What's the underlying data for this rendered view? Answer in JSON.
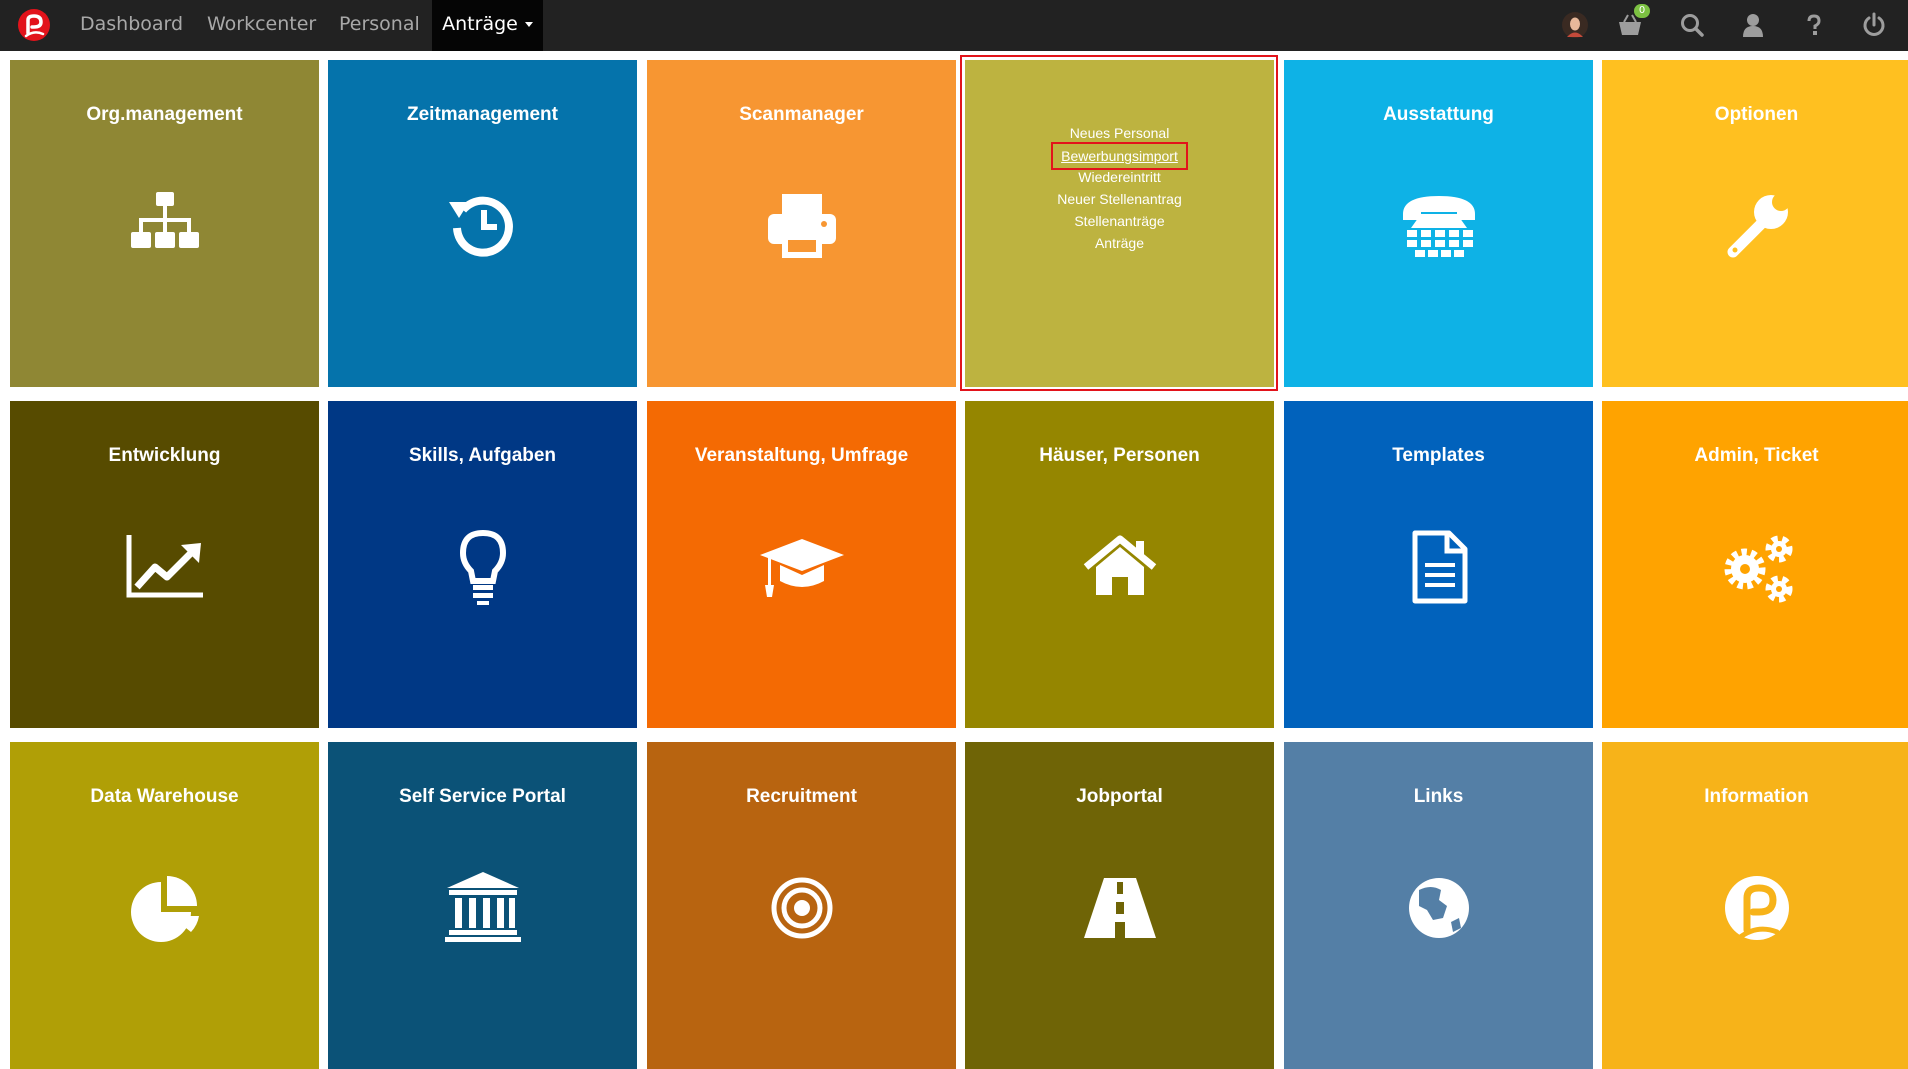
{
  "navbar": {
    "items": [
      {
        "label": "Dashboard"
      },
      {
        "label": "Workcenter"
      },
      {
        "label": "Personal"
      }
    ],
    "active": "Anträge",
    "cart_count": "0",
    "icons": [
      "avatar",
      "cart-icon",
      "search-icon",
      "user-icon",
      "help-icon",
      "power-icon"
    ]
  },
  "colors": {
    "navbar": "#222222",
    "highlight": "#e2131b"
  },
  "tiles": [
    {
      "title": "Org.management",
      "color": "#8f8734",
      "icon": "org-chart-icon"
    },
    {
      "title": "Zeitmanagement",
      "color": "#0573ab",
      "icon": "history-icon"
    },
    {
      "title": "Scanmanager",
      "color": "#f79632",
      "icon": "printer-icon"
    },
    {
      "title": "",
      "color": "#bdb340",
      "icon": "",
      "menu": [
        "Neues Personal",
        "Bewerbungsimport",
        "Wiedereintritt",
        "Neuer Stellenantrag",
        "Stellenanträge",
        "Anträge"
      ]
    },
    {
      "title": "Ausstattung",
      "color": "#0eb2e6",
      "icon": "phone-icon"
    },
    {
      "title": "Optionen",
      "color": "#ffc020",
      "icon": "wrench-icon"
    },
    {
      "title": "Entwicklung",
      "color": "#574b00",
      "icon": "chart-line-icon"
    },
    {
      "title": "Skills, Aufgaben",
      "color": "#003885",
      "icon": "lightbulb-icon"
    },
    {
      "title": "Veranstaltung, Umfrage",
      "color": "#f46a03",
      "icon": "graduation-cap-icon"
    },
    {
      "title": "Häuser, Personen",
      "color": "#958600",
      "icon": "home-icon"
    },
    {
      "title": "Templates",
      "color": "#0162bc",
      "icon": "document-icon"
    },
    {
      "title": "Admin, Ticket",
      "color": "#ffa300",
      "icon": "gears-icon"
    },
    {
      "title": "Data Warehouse",
      "color": "#b09f06",
      "icon": "pie-chart-icon"
    },
    {
      "title": "Self Service Portal",
      "color": "#0b5277",
      "icon": "bank-icon"
    },
    {
      "title": "Recruitment",
      "color": "#b86410",
      "icon": "target-icon"
    },
    {
      "title": "Jobportal",
      "color": "#6f6406",
      "icon": "road-icon"
    },
    {
      "title": "Links",
      "color": "#547fa6",
      "icon": "globe-icon"
    },
    {
      "title": "Information",
      "color": "#f7b319",
      "icon": "brand-logo-icon"
    }
  ]
}
